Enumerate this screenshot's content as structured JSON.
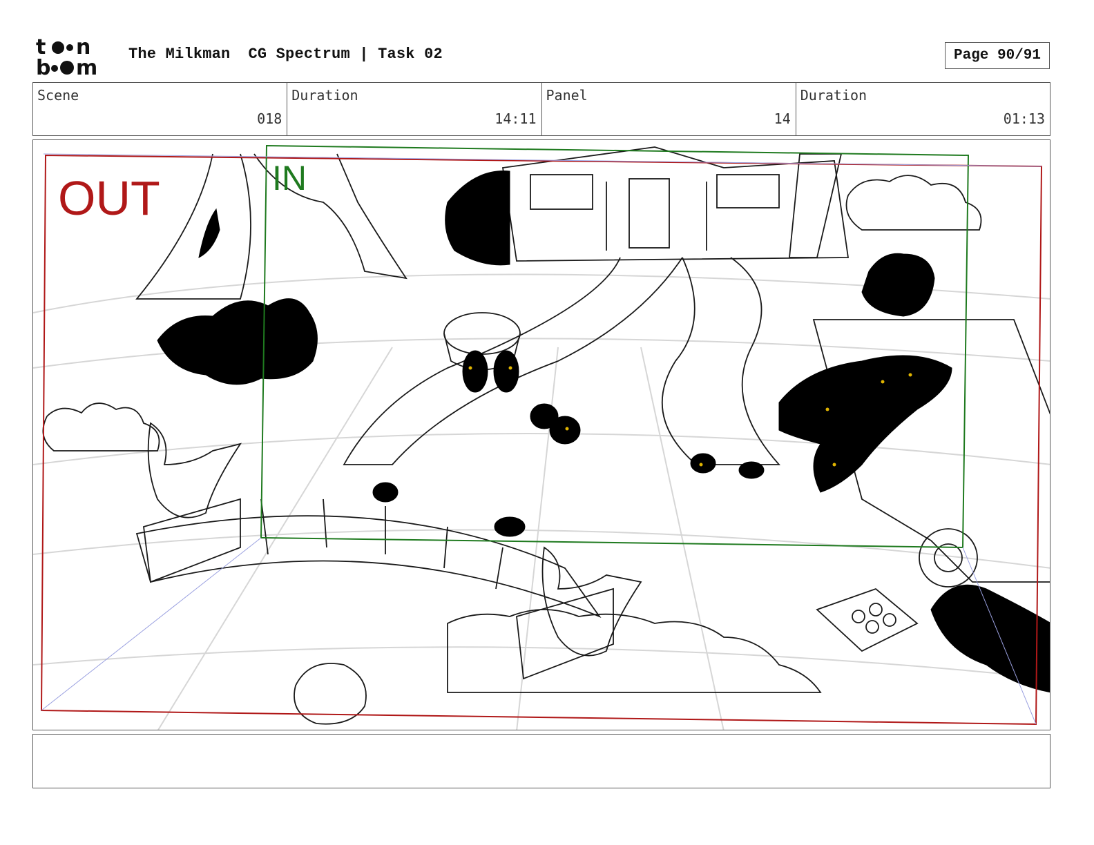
{
  "header": {
    "logo_text": "toonboom",
    "project_title": "The Milkman",
    "subtitle": "CG Spectrum | Task 02",
    "page_label": "Page 90/91"
  },
  "info": {
    "scene_label": "Scene",
    "scene_value": "018",
    "scene_duration_label": "Duration",
    "scene_duration_value": "14:11",
    "panel_label": "Panel",
    "panel_value": "14",
    "panel_duration_label": "Duration",
    "panel_duration_value": "01:13"
  },
  "frame": {
    "out_label": "OUT",
    "in_label": "IN",
    "out_color": "#b01818",
    "in_color": "#1f7a1f"
  },
  "notes": {
    "text": ""
  }
}
